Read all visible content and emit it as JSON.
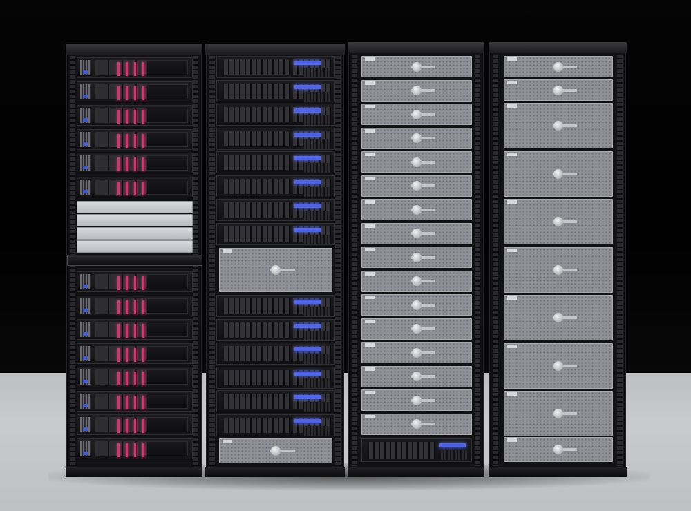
{
  "scene": {
    "subject": "server racks",
    "rack_count": 4,
    "colors": {
      "background": "#000000",
      "floor": "#c4c5c7",
      "rack_frame": "#121214",
      "led_red": "#d6336c",
      "lcd_blue": "#4f63e8",
      "mesh_grey": "#8f9196"
    }
  }
}
